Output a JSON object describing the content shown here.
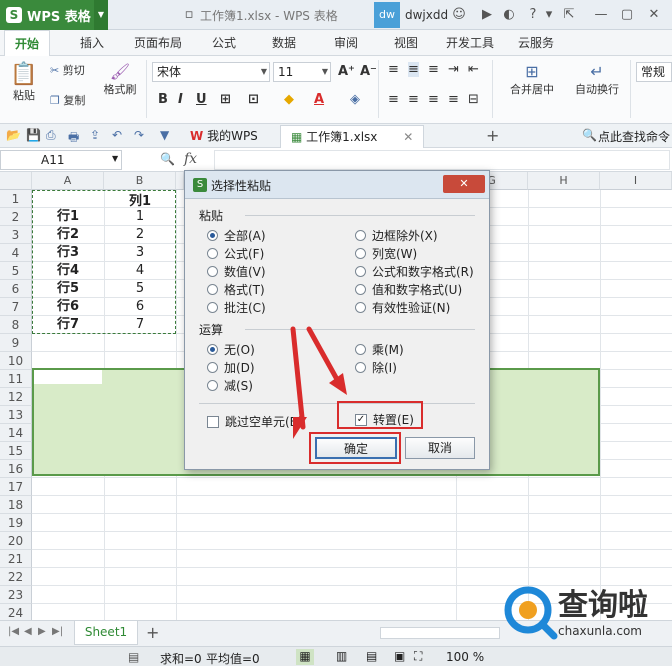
{
  "title_bar": {
    "app": "WPS 表格",
    "document": "工作簿1.xlsx - WPS 表格",
    "user_badge": "dw",
    "user": "dwjxdd"
  },
  "ribbon_tabs": [
    "开始",
    "插入",
    "页面布局",
    "公式",
    "数据",
    "审阅",
    "视图",
    "开发工具",
    "云服务"
  ],
  "ribbon": {
    "paste": "粘贴",
    "cut": "剪切",
    "copy": "复制",
    "format_painter": "格式刷",
    "font_name": "宋体",
    "font_size": "11",
    "merge_center": "合并居中",
    "wrap_text": "自动换行",
    "number_format": "常规"
  },
  "doc_tabs": [
    "我的WPS",
    "工作簿1.xlsx"
  ],
  "search_hint": "点此查找命令",
  "name_box": "A11",
  "fx": "fx",
  "columns": [
    "A",
    "B",
    "G",
    "H",
    "I"
  ],
  "rows": [
    "1",
    "2",
    "3",
    "4",
    "5",
    "6",
    "7",
    "8",
    "9",
    "10",
    "11",
    "12",
    "13",
    "14",
    "15",
    "16",
    "17",
    "18",
    "19",
    "20",
    "21",
    "22",
    "23",
    "24",
    "25"
  ],
  "cells": {
    "b1": "列1",
    "a": [
      "行1",
      "行2",
      "行3",
      "行4",
      "行5",
      "行6",
      "行7"
    ],
    "b": [
      "1",
      "2",
      "3",
      "4",
      "5",
      "6",
      "7"
    ]
  },
  "dialog": {
    "title": "选择性粘贴",
    "paste_label": "粘贴",
    "paste_left": [
      "全部(A)",
      "公式(F)",
      "数值(V)",
      "格式(T)",
      "批注(C)"
    ],
    "paste_right": [
      "边框除外(X)",
      "列宽(W)",
      "公式和数字格式(R)",
      "值和数字格式(U)",
      "有效性验证(N)"
    ],
    "operation_label": "运算",
    "op_left": [
      "无(O)",
      "加(D)",
      "减(S)"
    ],
    "op_right": [
      "乘(M)",
      "除(I)"
    ],
    "skip_blanks": "跳过空单元(B)",
    "transpose": "转置(E)",
    "ok": "确定",
    "cancel": "取消"
  },
  "sheet_tab": "Sheet1",
  "status": {
    "sum": "求和=0",
    "avg": "平均值=0",
    "zoom": "100 %"
  },
  "watermark": {
    "text": "查询啦",
    "url": "chaxunla.com"
  }
}
